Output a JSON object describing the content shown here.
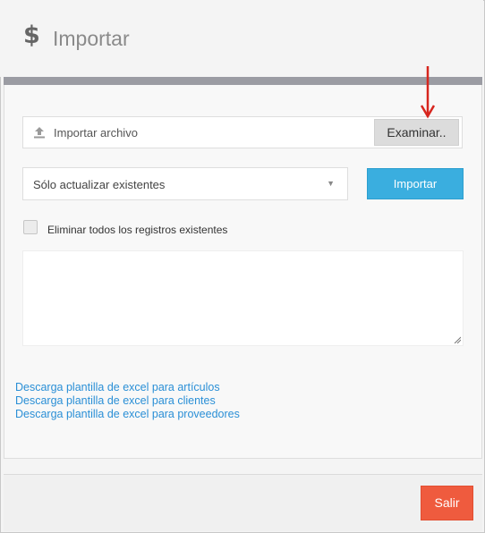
{
  "header": {
    "icon": "dollar-icon",
    "symbol": "$",
    "title": "Importar"
  },
  "file_input": {
    "icon": "upload-icon",
    "placeholder": "Importar archivo",
    "browse_label": "Examinar.."
  },
  "mode_select": {
    "selected": "Sólo actualizar existentes"
  },
  "import_button": {
    "label": "Importar",
    "color": "#3aaedf"
  },
  "delete_all": {
    "label": "Eliminar todos los registros existentes",
    "checked": false
  },
  "log_textarea": {
    "value": ""
  },
  "templates": {
    "links": [
      "Descarga plantilla de excel para artículos",
      "Descarga plantilla de excel para clientes",
      "Descarga plantilla de excel para proveedores"
    ]
  },
  "footer": {
    "exit_label": "Salir",
    "exit_color": "#ef5b3e"
  },
  "annotation": {
    "arrow_color": "#d7261e"
  }
}
